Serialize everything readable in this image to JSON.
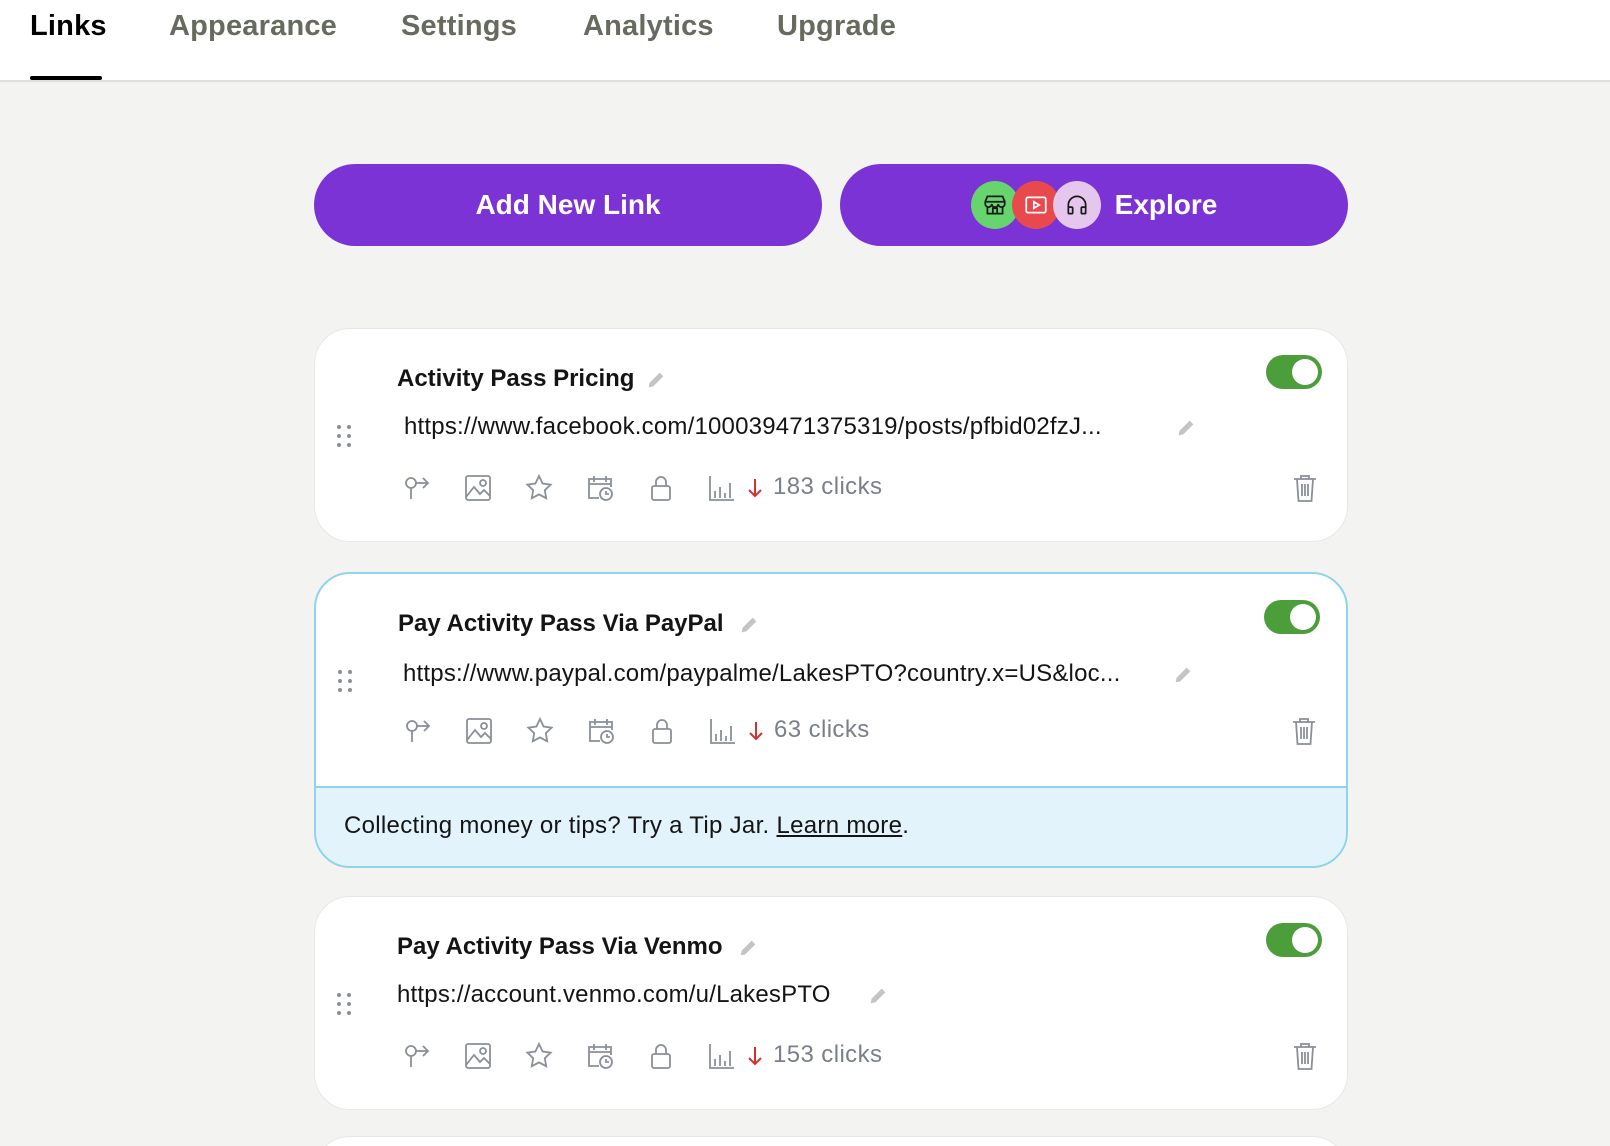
{
  "tabs": [
    "Links",
    "Appearance",
    "Settings",
    "Analytics",
    "Upgrade"
  ],
  "buttons": {
    "add_new_link": "Add New Link",
    "explore": "Explore"
  },
  "explore_icons": [
    "shop-icon",
    "video-play-icon",
    "headphones-icon"
  ],
  "colors": {
    "accent": "#7b33d6",
    "toggle_on": "#4b9e3a",
    "tip_bg": "#e3f3fb",
    "tip_border": "#8fd3ef",
    "click_arrow": "#d13232"
  },
  "links": [
    {
      "title": "Activity Pass Pricing",
      "url": "https://www.facebook.com/100039471375319/posts/pfbid02fzJ...",
      "clicks": "183 clicks",
      "enabled": true
    },
    {
      "title": "Pay Activity Pass Via PayPal",
      "url": "https://www.paypal.com/paypalme/LakesPTO?country.x=US&loc...",
      "clicks": "63 clicks",
      "enabled": true
    },
    {
      "title": "Pay Activity Pass Via Venmo",
      "url": "https://account.venmo.com/u/LakesPTO",
      "clicks": "153 clicks",
      "enabled": true
    }
  ],
  "tip": {
    "text": "Collecting money or tips? Try a Tip Jar. ",
    "link": "Learn more",
    "suffix": "."
  }
}
